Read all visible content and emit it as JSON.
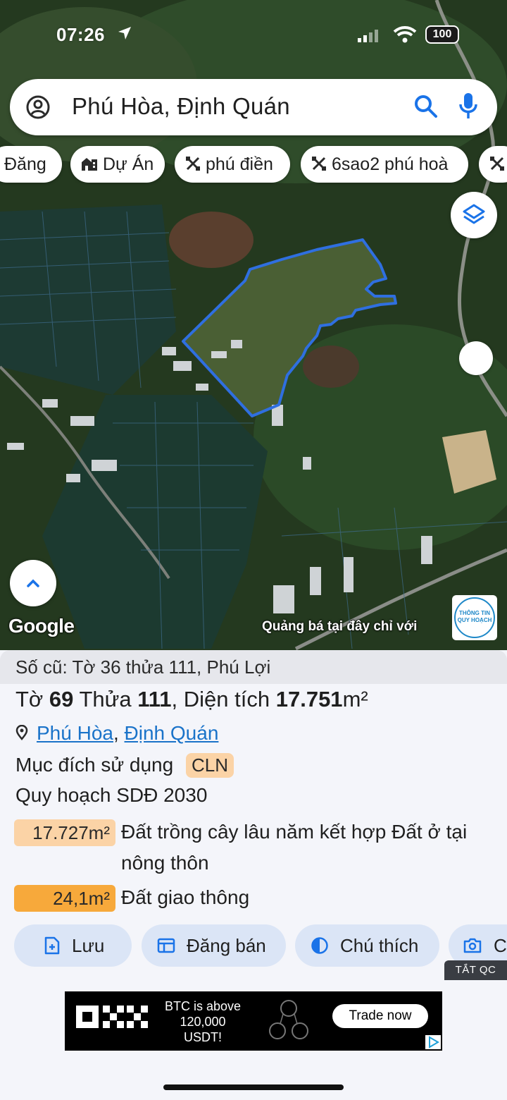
{
  "status_bar": {
    "time": "07:26",
    "battery": "100"
  },
  "search": {
    "query": "Phú Hòa, Định Quán"
  },
  "chips": [
    {
      "label": "Đăng",
      "icon": ""
    },
    {
      "label": "Dự Án",
      "icon": "building-icon"
    },
    {
      "label": "phú điền",
      "icon": "tool-icon"
    },
    {
      "label": "6sao2 phú hoà",
      "icon": "tool-icon"
    }
  ],
  "map": {
    "attribution": "Google",
    "promo_text": "Quảng bá tại đây chỉ với",
    "promo_logo_line1": "THÔNG TIN",
    "promo_logo_line2": "QUY HOẠCH"
  },
  "parcel": {
    "old_number": "Số cũ: Tờ 36 thửa 111, Phú Lợi",
    "sheet_prefix": "Tờ",
    "sheet": "69",
    "plot_prefix": "Thửa",
    "plot": "111",
    "area_prefix": ", Diện tích",
    "area": "17.751",
    "area_unit": "m²",
    "ward": "Phú Hòa",
    "district": "Định Quán",
    "purpose_label": "Mục đích sử dụng",
    "purpose_code": "CLN",
    "plan_label": "Quy hoạch SDĐ 2030",
    "zones": [
      {
        "area": "17.727m²",
        "desc": "Đất trồng cây lâu năm kết hợp Đất ở tại nông thôn",
        "color": "#fbd3a6"
      },
      {
        "area": "24,1m²",
        "desc": "Đất giao thông",
        "color": "#f7a93b"
      }
    ]
  },
  "actions": {
    "save": "Lưu",
    "sell": "Đăng bán",
    "legend": "Chú thích",
    "camera": "C"
  },
  "ad": {
    "hide_label": "TẮT QC",
    "line1": "BTC is above",
    "line2": "120,000 USDT!",
    "cta": "Trade now"
  },
  "colors": {
    "accent": "#1a73c9",
    "chip_bg": "#dbe5f6",
    "parcel_outline": "#2f6fe0"
  }
}
